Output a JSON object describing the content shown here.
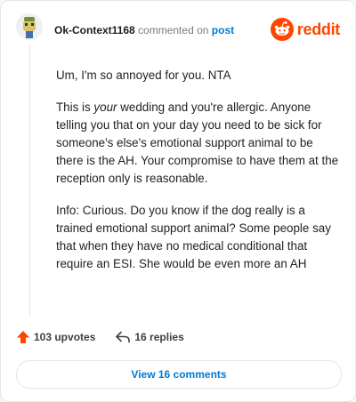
{
  "comment": {
    "username": "Ok-Context1168",
    "action": "commented on",
    "target": "post",
    "paragraph1": "Um, I'm so annoyed for you. NTA",
    "paragraph2_pre": "This is ",
    "paragraph2_em": "your",
    "paragraph2_post": " wedding and you're allergic. Anyone telling you that on your day you need to be sick for someone's else's emotional support animal to be there is the AH. Your compromise to have them at the reception only is reasonable.",
    "paragraph3": "Info: Curious. Do you know if the dog really is a trained emotional support animal? Some people say that when they have no medical conditional that require an ESI. She would be even more an AH"
  },
  "brand": {
    "name": "reddit",
    "color": "#ff4500"
  },
  "stats": {
    "upvotes": "103 upvotes",
    "replies": "16 replies"
  },
  "footer": {
    "view_comments": "View 16 comments"
  },
  "icons": {
    "avatar": "snoo-avatar-icon",
    "upvote": "upvote-arrow-icon",
    "reply": "reply-icon",
    "logo": "reddit-snoo-icon"
  }
}
